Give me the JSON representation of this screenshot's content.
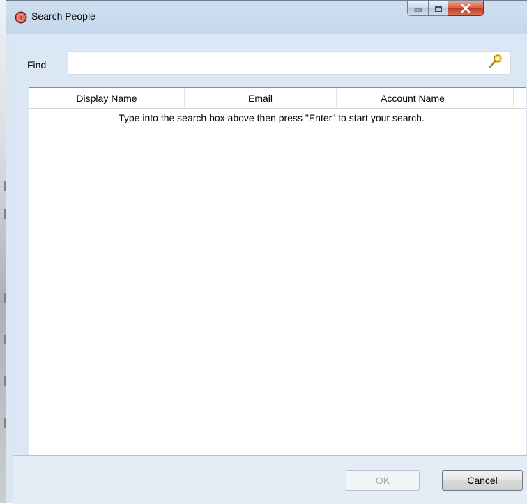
{
  "window": {
    "title": "Search People",
    "icon": "app-circle-icon",
    "controls": {
      "minimize": "minimize-icon",
      "maximize": "maximize-icon",
      "close": "close-icon"
    }
  },
  "search": {
    "label": "Find",
    "value": "",
    "placeholder": "",
    "icon": "search-key-icon"
  },
  "grid": {
    "columns": [
      "Display Name",
      "Email",
      "Account Name",
      ""
    ],
    "rows": [],
    "empty_message": "Type into the search box above then press \"Enter\" to start your search."
  },
  "buttons": {
    "ok": "OK",
    "cancel": "Cancel"
  },
  "colors": {
    "close_button": "#c23a1f",
    "app_icon": "#c0392b"
  }
}
